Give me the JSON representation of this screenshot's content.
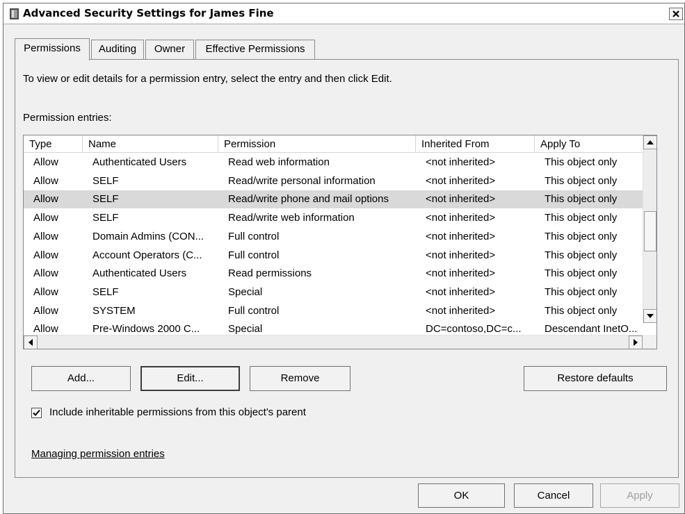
{
  "window": {
    "title": "Advanced Security Settings for James Fine"
  },
  "tabs": [
    {
      "label": "Permissions",
      "active": true
    },
    {
      "label": "Auditing",
      "active": false
    },
    {
      "label": "Owner",
      "active": false
    },
    {
      "label": "Effective Permissions",
      "active": false
    }
  ],
  "instructions": "To view or edit details for a permission entry, select the entry and then click Edit.",
  "entries_label": "Permission entries:",
  "list": {
    "columns": [
      "Type",
      "Name",
      "Permission",
      "Inherited From",
      "Apply To"
    ],
    "rows": [
      [
        "Allow",
        "Authenticated Users",
        "Read web information",
        "<not inherited>",
        "This object only"
      ],
      [
        "Allow",
        "SELF",
        "Read/write personal information",
        "<not inherited>",
        "This object only"
      ],
      [
        "Allow",
        "SELF",
        "Read/write phone and mail options",
        "<not inherited>",
        "This object only"
      ],
      [
        "Allow",
        "SELF",
        "Read/write web information",
        "<not inherited>",
        "This object only"
      ],
      [
        "Allow",
        "Domain Admins (CON...",
        "Full control",
        "<not inherited>",
        "This object only"
      ],
      [
        "Allow",
        "Account Operators (C...",
        "Full control",
        "<not inherited>",
        "This object only"
      ],
      [
        "Allow",
        "Authenticated Users",
        "Read permissions",
        "<not inherited>",
        "This object only"
      ],
      [
        "Allow",
        "SELF",
        "Special",
        "<not inherited>",
        "This object only"
      ],
      [
        "Allow",
        "SYSTEM",
        "Full control",
        "<not inherited>",
        "This object only"
      ],
      [
        "Allow",
        "Pre-Windows 2000 C...",
        "Special",
        "DC=contoso,DC=c...",
        "Descendant InetO..."
      ]
    ],
    "selected_row": 2
  },
  "buttons": {
    "add": "Add...",
    "edit": "Edit...",
    "remove": "Remove",
    "restore": "Restore defaults",
    "ok": "OK",
    "cancel": "Cancel",
    "apply": "Apply"
  },
  "checkbox": {
    "label": "Include inheritable permissions from this object's parent",
    "checked": true
  },
  "link": "Managing permission entries",
  "icons": [
    "window-icon",
    "close-icon",
    "scroll-up-icon",
    "scroll-down-icon",
    "scroll-left-icon",
    "scroll-right-icon",
    "checkmark-icon"
  ]
}
